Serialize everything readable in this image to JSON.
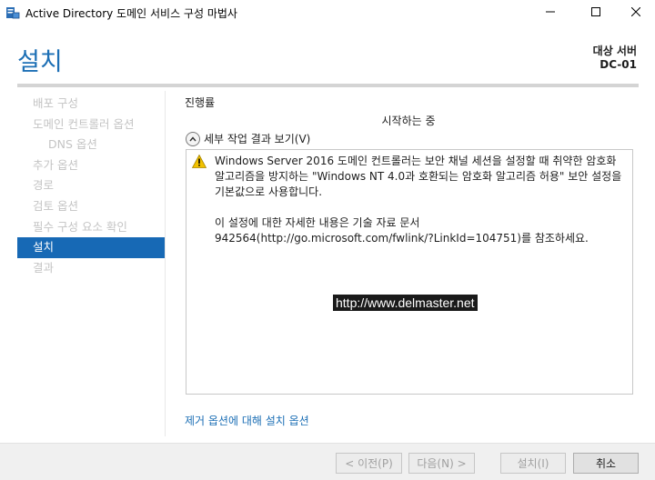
{
  "window": {
    "title": "Active Directory 도메인 서비스 구성 마법사",
    "icon": "server-manager-icon"
  },
  "header": {
    "title": "설치",
    "target_label": "대상 서버",
    "target_server": "DC-01"
  },
  "nav": {
    "items": [
      {
        "label": "배포 구성",
        "state": "disabled"
      },
      {
        "label": "도메인 컨트롤러 옵션",
        "state": "disabled"
      },
      {
        "label": "DNS 옵션",
        "state": "disabled",
        "sub": true
      },
      {
        "label": "추가 옵션",
        "state": "disabled"
      },
      {
        "label": "경로",
        "state": "disabled"
      },
      {
        "label": "검토 옵션",
        "state": "disabled"
      },
      {
        "label": "필수 구성 요소 확인",
        "state": "disabled"
      },
      {
        "label": "설치",
        "state": "active"
      },
      {
        "label": "결과",
        "state": "disabled"
      }
    ]
  },
  "main": {
    "progress_label": "진행률",
    "status": "시작하는 중",
    "details_toggle": "세부 작업 결과 보기(V)",
    "warning_p1": "Windows Server 2016 도메인 컨트롤러는 보안 채널 세션을 설정할 때 취약한 암호화 알고리즘을 방지하는 \"Windows NT 4.0과 호환되는 암호화 알고리즘 허용\" 보안 설정을 기본값으로 사용합니다.",
    "warning_p2": "이 설정에 대한 자세한 내용은 기술 자료 문서 942564(http://go.microsoft.com/fwlink/?LinkId=104751)를 참조하세요.",
    "watermark": "http://www.delmaster.net",
    "bottom_link": "제거 옵션에 대해 설치 옵션"
  },
  "footer": {
    "prev": "< 이전(P)",
    "next": "다음(N) >",
    "install": "설치(I)",
    "cancel": "취소"
  },
  "colors": {
    "accent": "#1c6fb5",
    "nav_active": "#1769b5",
    "warning": "#f2c200"
  }
}
